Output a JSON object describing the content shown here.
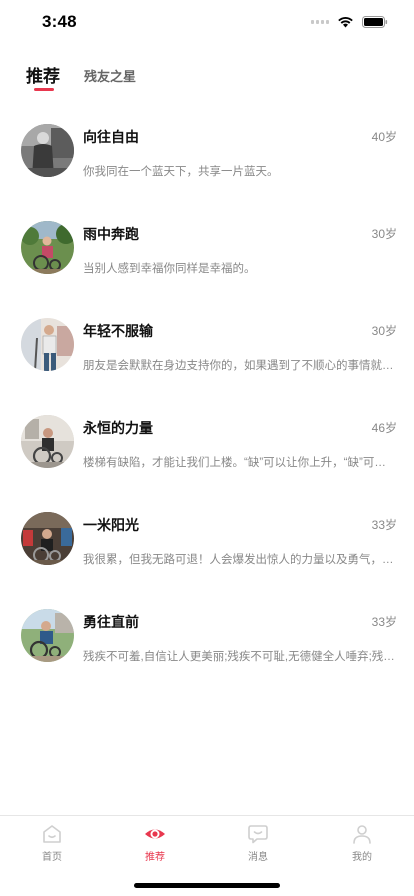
{
  "status_bar": {
    "time": "3:48"
  },
  "top_tabs": [
    {
      "label": "推荐",
      "active": true
    },
    {
      "label": "残友之星",
      "active": false
    }
  ],
  "items": [
    {
      "name": "向往自由",
      "age": "40岁",
      "desc": "你我同在一个蓝天下，共享一片蓝天。",
      "avatar": "person-standing-photo"
    },
    {
      "name": "雨中奔跑",
      "age": "30岁",
      "desc": "当别人感到幸福你同样是幸福的。",
      "avatar": "wheelchair-outdoor-photo"
    },
    {
      "name": "年轻不服输",
      "age": "30岁",
      "desc": "朋友是会默默在身边支持你的，如果遇到了不顺心的事情就找朋友倾诉吧。",
      "avatar": "person-crutch-photo"
    },
    {
      "name": "永恒的力量",
      "age": "46岁",
      "desc": "楼梯有缺陷，才能让我们上楼。“缺”可以让你上升，“缺”可以让你进步。",
      "avatar": "wheelchair-indoor-photo"
    },
    {
      "name": "一米阳光",
      "age": "33岁",
      "desc": "我很累，但我无路可退！人会爆发出惊人的力量以及勇气，去战胜困难。",
      "avatar": "wheelchair-group-photo"
    },
    {
      "name": "勇往直前",
      "age": "33岁",
      "desc": "残疾不可羞,自信让人更美丽;残疾不可耻,无德健全人唾弃;残疾不可怕。",
      "avatar": "wheelchair-street-photo"
    }
  ],
  "tabbar": [
    {
      "label": "首页",
      "icon": "home-icon",
      "active": false
    },
    {
      "label": "推荐",
      "icon": "eye-icon",
      "active": true
    },
    {
      "label": "消息",
      "icon": "message-icon",
      "active": false
    },
    {
      "label": "我的",
      "icon": "user-icon",
      "active": false
    }
  ],
  "colors": {
    "accent": "#e8374e",
    "muted": "#888888",
    "tab_inactive": "#cccccc"
  }
}
